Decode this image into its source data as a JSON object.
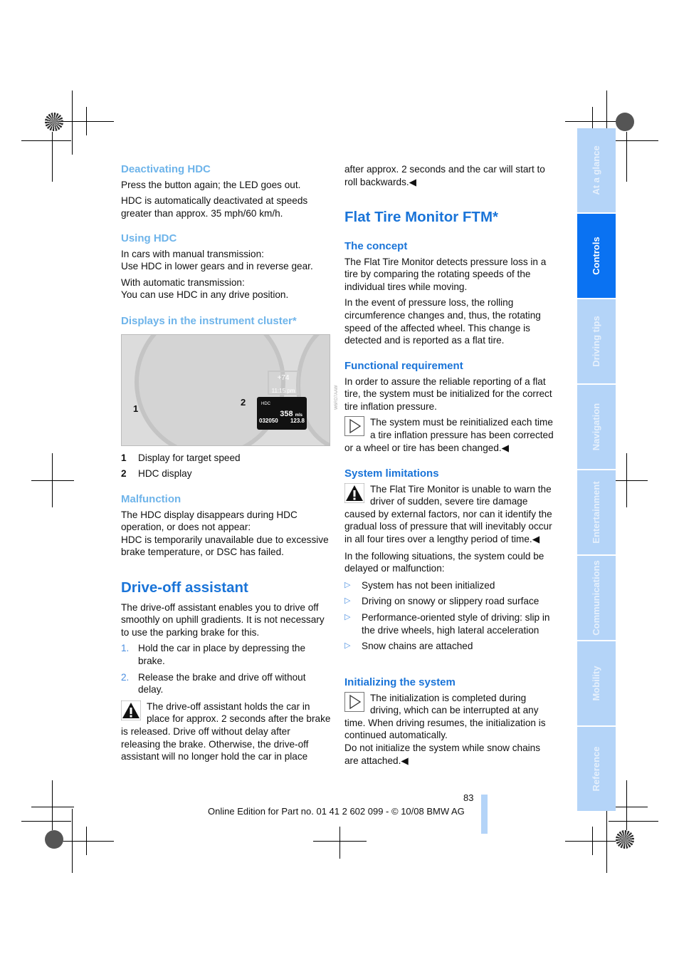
{
  "left": {
    "deactivating": {
      "title": "Deactivating HDC",
      "p1": "Press the button again; the LED goes out.",
      "p2": "HDC is automatically deactivated at speeds greater than approx. 35 mph/60 km/h."
    },
    "using": {
      "title": "Using HDC",
      "p1a": "In cars with manual transmission:",
      "p1b": "Use HDC in lower gears and in reverse gear.",
      "p2a": "With automatic transmission:",
      "p2b": "You can use HDC in any drive position."
    },
    "displays": {
      "title": "Displays in the instrument cluster*",
      "figure": {
        "callout1": "1",
        "callout2": "2",
        "hdc": "HDC",
        "range": "358",
        "range_unit": "mls",
        "odo": "032050",
        "trip": "123.8",
        "temp": "+74",
        "time": "11:15 pm",
        "code": "W6RD7AAW"
      },
      "legend": [
        {
          "n": "1",
          "text": "Display for target speed"
        },
        {
          "n": "2",
          "text": "HDC display"
        }
      ]
    },
    "malfunction": {
      "title": "Malfunction",
      "p1": "The HDC display disappears during HDC operation, or does not appear:",
      "p2": "HDC is temporarily unavailable due to excessive brake temperature, or DSC has failed."
    },
    "driveoff": {
      "title": "Drive-off assistant",
      "p1": "The drive-off assistant enables you to drive off smoothly on uphill gradients. It is not necessary to use the parking brake for this.",
      "steps": [
        {
          "n": "1.",
          "text": "Hold the car in place by depressing the brake."
        },
        {
          "n": "2.",
          "text": "Release the brake and drive off without delay."
        }
      ],
      "warning": "The drive-off assistant holds the car in place for approx. 2 seconds after the brake is released. Drive off without delay after releasing the brake. Otherwise, the drive-off assistant will no longer hold the car in place"
    }
  },
  "right": {
    "cont": "after approx. 2 seconds and the car will start to roll backwards.◀",
    "ftm": {
      "title": "Flat Tire Monitor FTM*"
    },
    "concept": {
      "title": "The concept",
      "p1": "The Flat Tire Monitor detects pressure loss in a tire by comparing the rotating speeds of the individual tires while moving.",
      "p2": "In the event of pressure loss, the rolling circumference changes and, thus, the rotating speed of the affected wheel. This change is detected and is reported as a flat tire."
    },
    "functional": {
      "title": "Functional requirement",
      "p1": "In order to assure the reliable reporting of a flat tire, the system must be initialized for the correct tire inflation pressure.",
      "note": "The system must be reinitialized each time a tire inflation pressure has been corrected or a wheel or tire has been changed.◀"
    },
    "limits": {
      "title": "System limitations",
      "warning": "The Flat Tire Monitor is unable to warn the driver of sudden, severe tire damage caused by external factors, nor can it identify the gradual loss of pressure that will inevitably occur in all four tires over a lengthy period of time.◀",
      "p1": "In the following situations, the system could be delayed or malfunction:",
      "bullets": [
        "System has not been initialized",
        "Driving on snowy or slippery road surface",
        "Performance-oriented style of driving: slip in the drive wheels, high lateral acceleration",
        "Snow chains are attached"
      ]
    },
    "init": {
      "title": "Initializing the system",
      "note": "The initialization is completed during driving, which can be interrupted at any time. When driving resumes, the initialization is continued automatically.",
      "p2": "Do not initialize the system while snow chains are attached.◀"
    }
  },
  "tabs": [
    {
      "label": "At a glance"
    },
    {
      "label": "Controls",
      "active": true
    },
    {
      "label": "Driving tips"
    },
    {
      "label": "Navigation"
    },
    {
      "label": "Entertainment"
    },
    {
      "label": "Communications"
    },
    {
      "label": "Mobility"
    },
    {
      "label": "Reference"
    }
  ],
  "footer": {
    "page": "83",
    "text": "Online Edition for Part no. 01 41 2 602 099 - © 10/08 BMW AG"
  },
  "colors": {
    "heading": "#1a74d8",
    "subheading_light": "#6eb4ea",
    "tab": "#b4d4f8",
    "tab_active": "#0a72f2"
  }
}
